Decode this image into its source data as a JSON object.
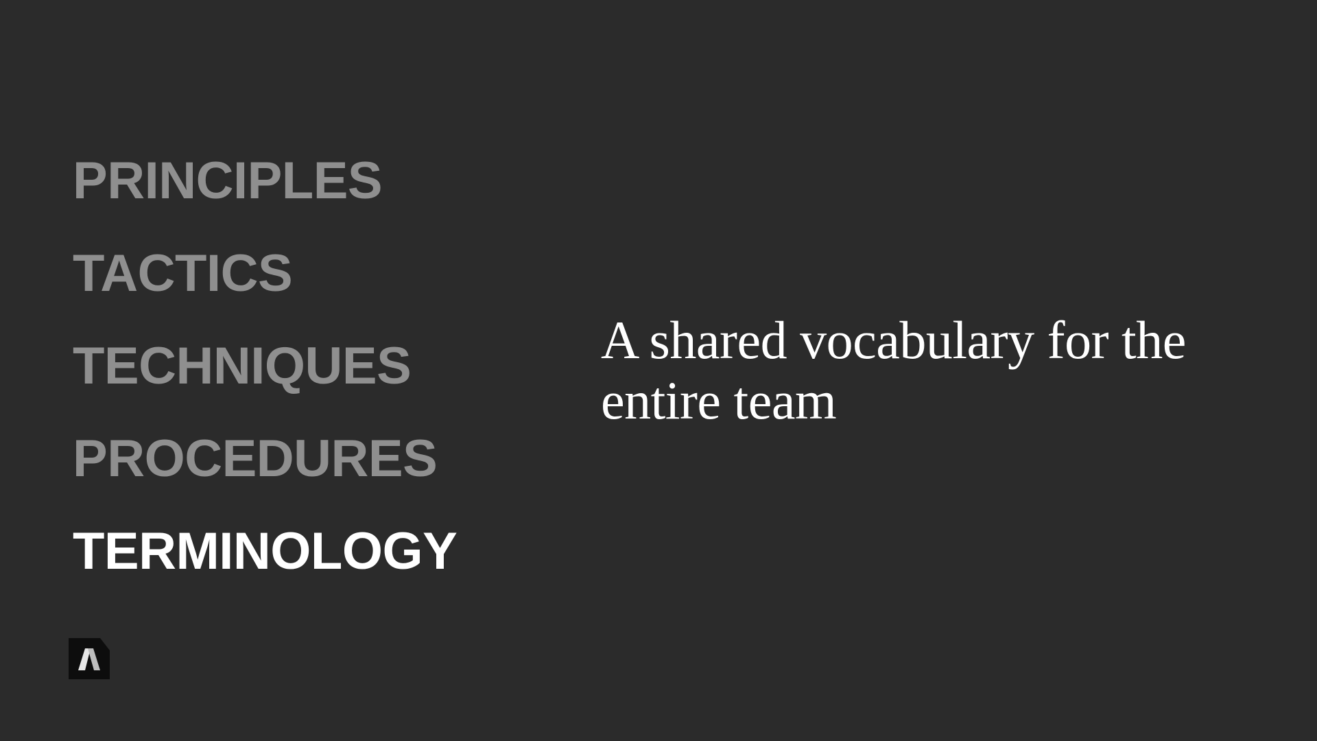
{
  "nav": {
    "items": [
      {
        "label": "PRINCIPLES",
        "active": false
      },
      {
        "label": "TACTICS",
        "active": false
      },
      {
        "label": "TECHNIQUES",
        "active": false
      },
      {
        "label": "PROCEDURES",
        "active": false
      },
      {
        "label": "TERMINOLOGY",
        "active": true
      }
    ]
  },
  "main": {
    "tagline": "A shared vocabulary for the entire team"
  },
  "logo": {
    "icon": "logo-a-icon",
    "letter": "A"
  },
  "colors": {
    "background": "#2b2b2b",
    "inactive_text": "#8f8f8f",
    "active_text": "#ffffff",
    "logo_bg": "#0d0d0d"
  }
}
